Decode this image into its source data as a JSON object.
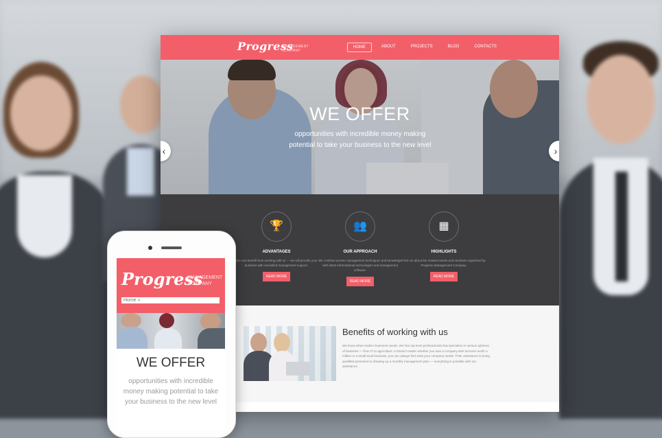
{
  "brand": {
    "name": "Progress",
    "tagline": "MANAGEMENT COMPANY",
    "accent": "#f35f69",
    "dark": "#3d3d3f"
  },
  "nav": {
    "items": [
      "HOME",
      "ABOUT",
      "PROJECTS",
      "BLOG",
      "CONTACTS"
    ],
    "active": "HOME"
  },
  "hero": {
    "title": "WE OFFER",
    "text": "opportunities with incredible money making potential to take your business to the new level",
    "prev_icon": "chevron-left-icon",
    "next_icon": "chevron-right-icon"
  },
  "features": [
    {
      "icon": "trophy-icon",
      "title": "ADVANTAGES",
      "text": "You can benefit from working with us — we will provide your business with unrivalled management support.",
      "button": "READ MORE"
    },
    {
      "icon": "team-icon",
      "title": "OUR APPROACH",
      "text": "We combine proven management techniques and knowledge with latest informational technologies and management software.",
      "button": "READ MORE"
    },
    {
      "icon": "calendar-icon",
      "title": "HIGHLIGHTS",
      "text": "Find out about the newest events and seminars organized by Progress Management Company.",
      "button": "READ MORE"
    }
  ],
  "benefits": {
    "title": "Benefits of working with us",
    "text": "We know what modern business needs. We hire top level professionals that specialize in various spheres of business — from IT to agriculture. It doesn't matter whether you own a company with turnover worth a million or a small local business, you can always find what your company needs. Their assistance is being qualified personnel to drawing up a monthly management plan — everything is possible with our assistance."
  },
  "mobile": {
    "logo": "Progress",
    "tagline": "MANAGEMENT COMPANY",
    "menu_select": "Home »",
    "title": "WE OFFER",
    "text": "opportunities with incredible money making potential to take your business to the new level"
  }
}
